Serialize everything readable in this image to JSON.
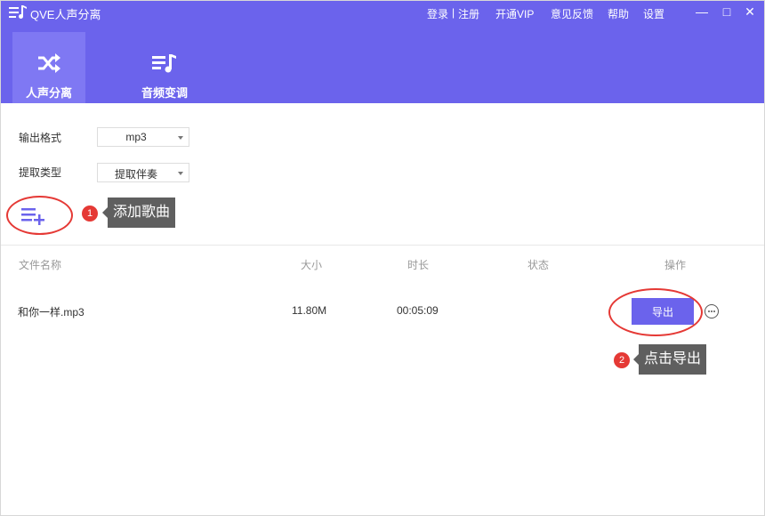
{
  "app": {
    "title": "QVE人声分离"
  },
  "topbar": {
    "login": "登录",
    "sep": "|",
    "register": "注册",
    "vip": "开通VIP",
    "feedback": "意见反馈",
    "help": "帮助",
    "settings": "设置"
  },
  "window_controls": {
    "minimize": "—",
    "maximize": "□",
    "close": "✕"
  },
  "tabs": [
    {
      "label": "人声分离",
      "icon": "shuffle-icon",
      "active": true
    },
    {
      "label": "音频变调",
      "icon": "music-list-icon",
      "active": false
    }
  ],
  "settings": {
    "format_label": "输出格式",
    "format_value": "mp3",
    "type_label": "提取类型",
    "type_value": "提取伴奏"
  },
  "annotations": [
    {
      "number": "1",
      "text": "添加歌曲"
    },
    {
      "number": "2",
      "text": "点击导出"
    }
  ],
  "table": {
    "headers": [
      "文件名称",
      "大小",
      "时长",
      "状态",
      "操作"
    ],
    "rows": [
      {
        "name": "和你一样.mp3",
        "size": "11.80M",
        "duration": "00:05:09",
        "status": "",
        "action": "导出"
      }
    ]
  },
  "colors": {
    "accent": "#6b63ec",
    "accent_light": "#7f78f3",
    "annotation_red": "#e53935",
    "tip_bg": "#5f5f5f"
  }
}
